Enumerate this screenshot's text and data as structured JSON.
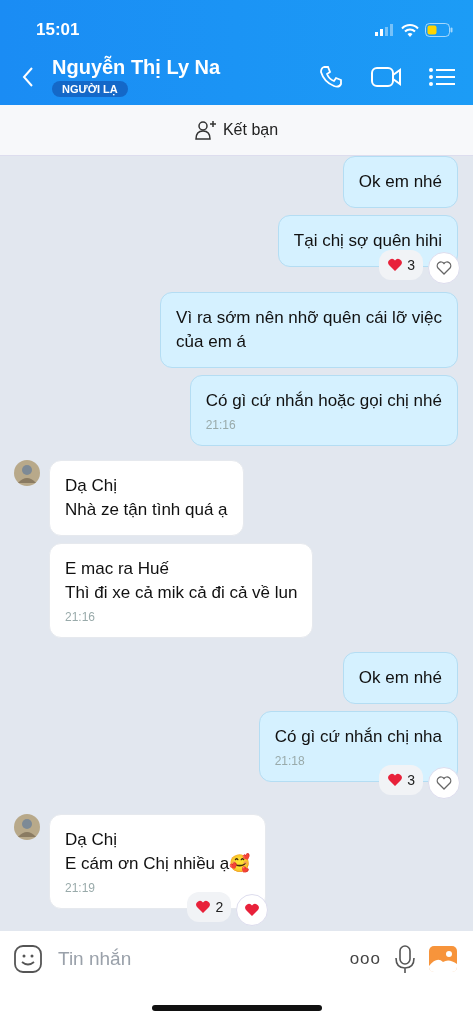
{
  "status_bar": {
    "time": "15:01"
  },
  "header": {
    "name": "Nguyễn Thị Ly Na",
    "badge": "NGƯỜI LẠ"
  },
  "add_friend": {
    "label": "Kết bạn"
  },
  "messages": [
    {
      "kind": "out",
      "text": "Ok em nhé",
      "avatar": false
    },
    {
      "kind": "out",
      "text": "Tại chị sợ quên hihi",
      "avatar": false,
      "reaction_count": "3",
      "liked": false
    },
    {
      "kind": "out",
      "text": "Vì ra sớm nên nhỡ quên cái lỡ việc\ncủa em á",
      "avatar": false
    },
    {
      "kind": "out",
      "text": "Có gì cứ nhắn hoặc gọi chị nhé",
      "time": "21:16",
      "avatar": false
    },
    {
      "kind": "in",
      "text": "Dạ Chị\nNhà ze tận tình quá ạ",
      "avatar": true
    },
    {
      "kind": "in",
      "text": "E mac ra Huế\nThì đi xe cả mik cả đi cả về lun",
      "time": "21:16",
      "avatar": false
    },
    {
      "kind": "out",
      "text": "Ok em nhé",
      "avatar": false
    },
    {
      "kind": "out",
      "text": "Có gì cứ nhắn chị nha",
      "time": "21:18",
      "avatar": false,
      "reaction_count": "3",
      "liked": false
    },
    {
      "kind": "in",
      "text": "Dạ Chị\nE cám ơn Chị nhiều ạ🥰",
      "time": "21:19",
      "avatar": true,
      "reaction_count": "2",
      "liked": true
    }
  ],
  "composer": {
    "placeholder": "Tin nhắn",
    "more": "ooo"
  }
}
